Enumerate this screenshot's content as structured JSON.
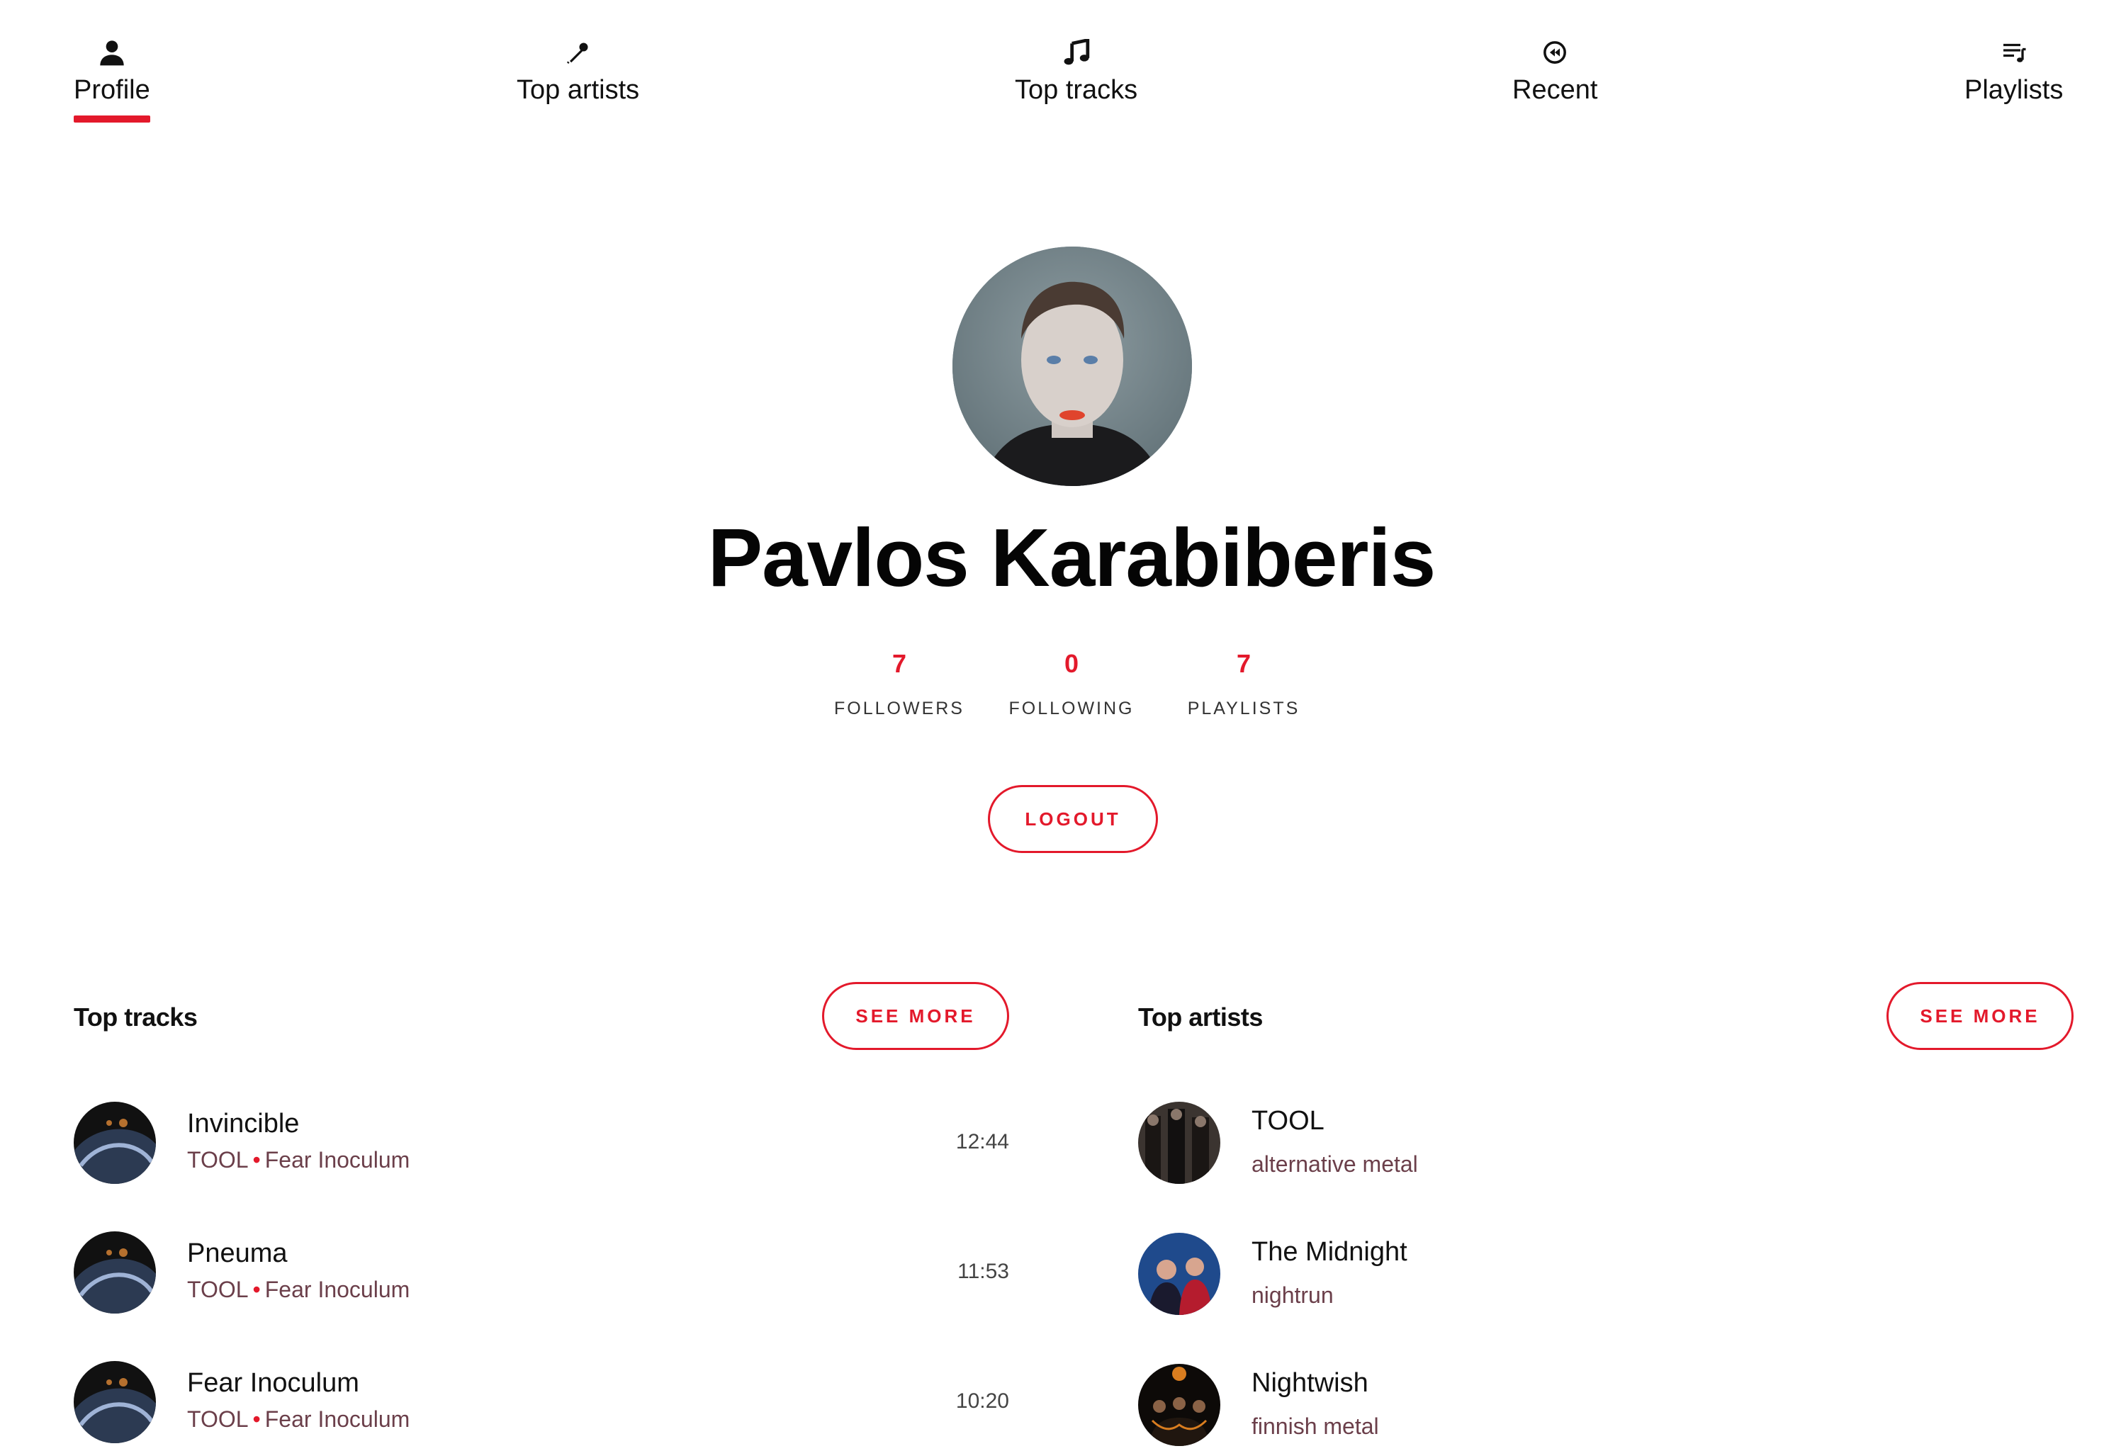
{
  "nav": [
    {
      "id": "profile",
      "label": "Profile",
      "icon": "user-icon",
      "active": true
    },
    {
      "id": "artists",
      "label": "Top artists",
      "icon": "microphone-icon",
      "active": false
    },
    {
      "id": "tracks",
      "label": "Top tracks",
      "icon": "music-note-icon",
      "active": false
    },
    {
      "id": "recent",
      "label": "Recent",
      "icon": "rewind-icon",
      "active": false
    },
    {
      "id": "playlists",
      "label": "Playlists",
      "icon": "playlist-icon",
      "active": false
    }
  ],
  "profile": {
    "name": "Pavlos Karabiberis",
    "stats": [
      {
        "value": "7",
        "label": "FOLLOWERS"
      },
      {
        "value": "0",
        "label": "FOLLOWING"
      },
      {
        "value": "7",
        "label": "PLAYLISTS"
      }
    ],
    "logout_label": "LOGOUT"
  },
  "top_tracks": {
    "title": "Top tracks",
    "see_more_label": "SEE MORE",
    "items": [
      {
        "title": "Invincible",
        "artist": "TOOL",
        "separator": "•",
        "album": "Fear Inoculum",
        "duration": "12:44"
      },
      {
        "title": "Pneuma",
        "artist": "TOOL",
        "separator": "•",
        "album": "Fear Inoculum",
        "duration": "11:53"
      },
      {
        "title": "Fear Inoculum",
        "artist": "TOOL",
        "separator": "•",
        "album": "Fear Inoculum",
        "duration": "10:20"
      }
    ]
  },
  "top_artists": {
    "title": "Top artists",
    "see_more_label": "SEE MORE",
    "items": [
      {
        "name": "TOOL",
        "genre": "alternative metal"
      },
      {
        "name": "The Midnight",
        "genre": "nightrun"
      },
      {
        "name": "Nightwish",
        "genre": "finnish metal"
      }
    ]
  },
  "colors": {
    "accent": "#e3192b",
    "subtext": "#6b3f4a"
  }
}
